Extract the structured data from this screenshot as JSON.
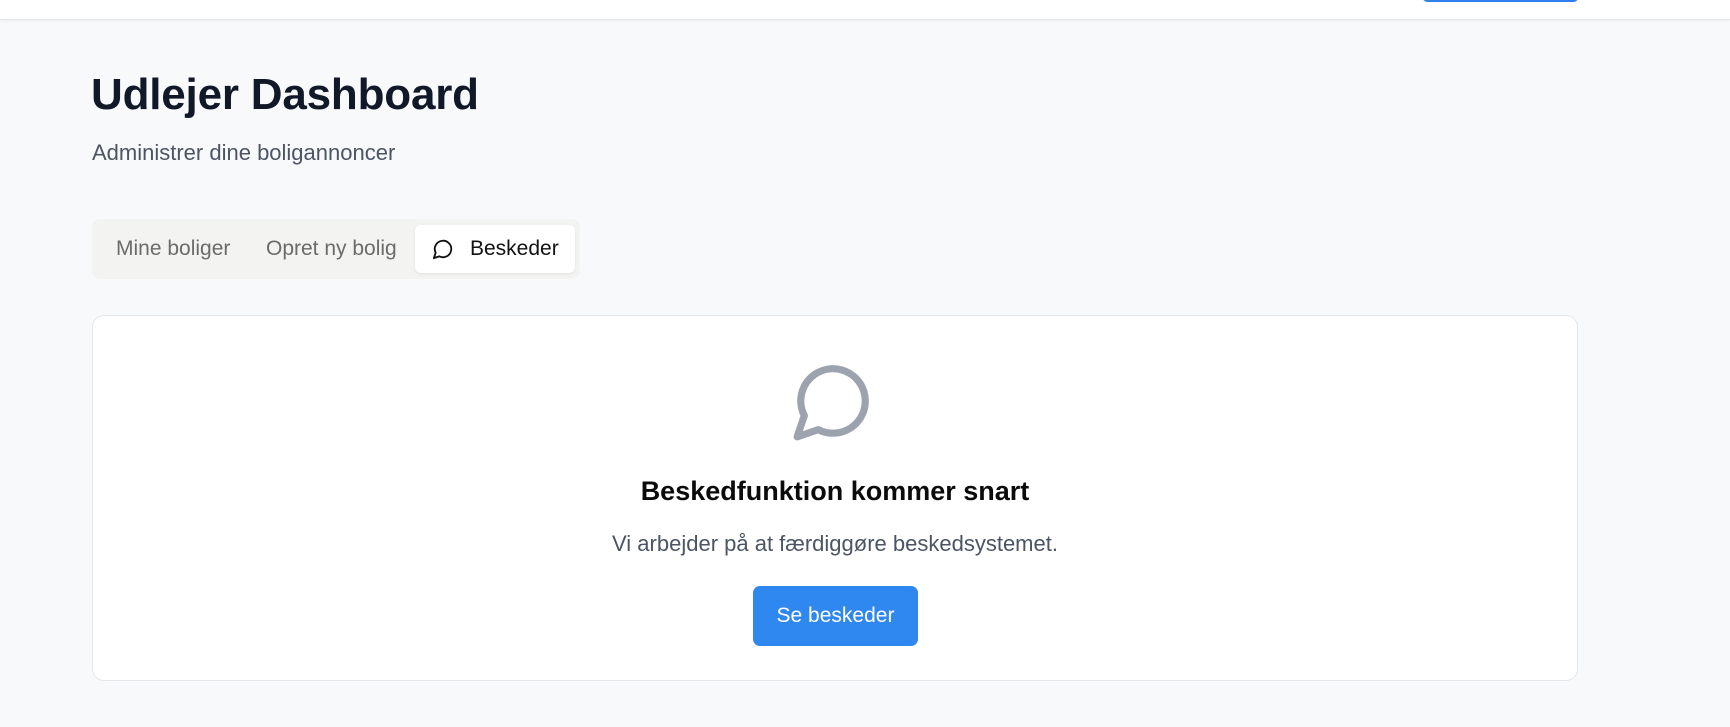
{
  "header": {
    "title": "Udlejer Dashboard",
    "subtitle": "Administrer dine boligannoncer"
  },
  "tabs": [
    {
      "label": "Mine boliger",
      "active": false
    },
    {
      "label": "Opret ny bolig",
      "active": false
    },
    {
      "label": "Beskeder",
      "active": true,
      "icon": "message-circle-icon"
    }
  ],
  "empty_state": {
    "icon": "message-circle-icon",
    "heading": "Beskedfunktion kommer snart",
    "text": "Vi arbejder på at færdiggøre beskedsystemet.",
    "button_label": "Se beskeder"
  },
  "colors": {
    "accent": "#2f87f0",
    "page_background": "#f8f9fb",
    "icon_muted": "#9ca3af"
  }
}
